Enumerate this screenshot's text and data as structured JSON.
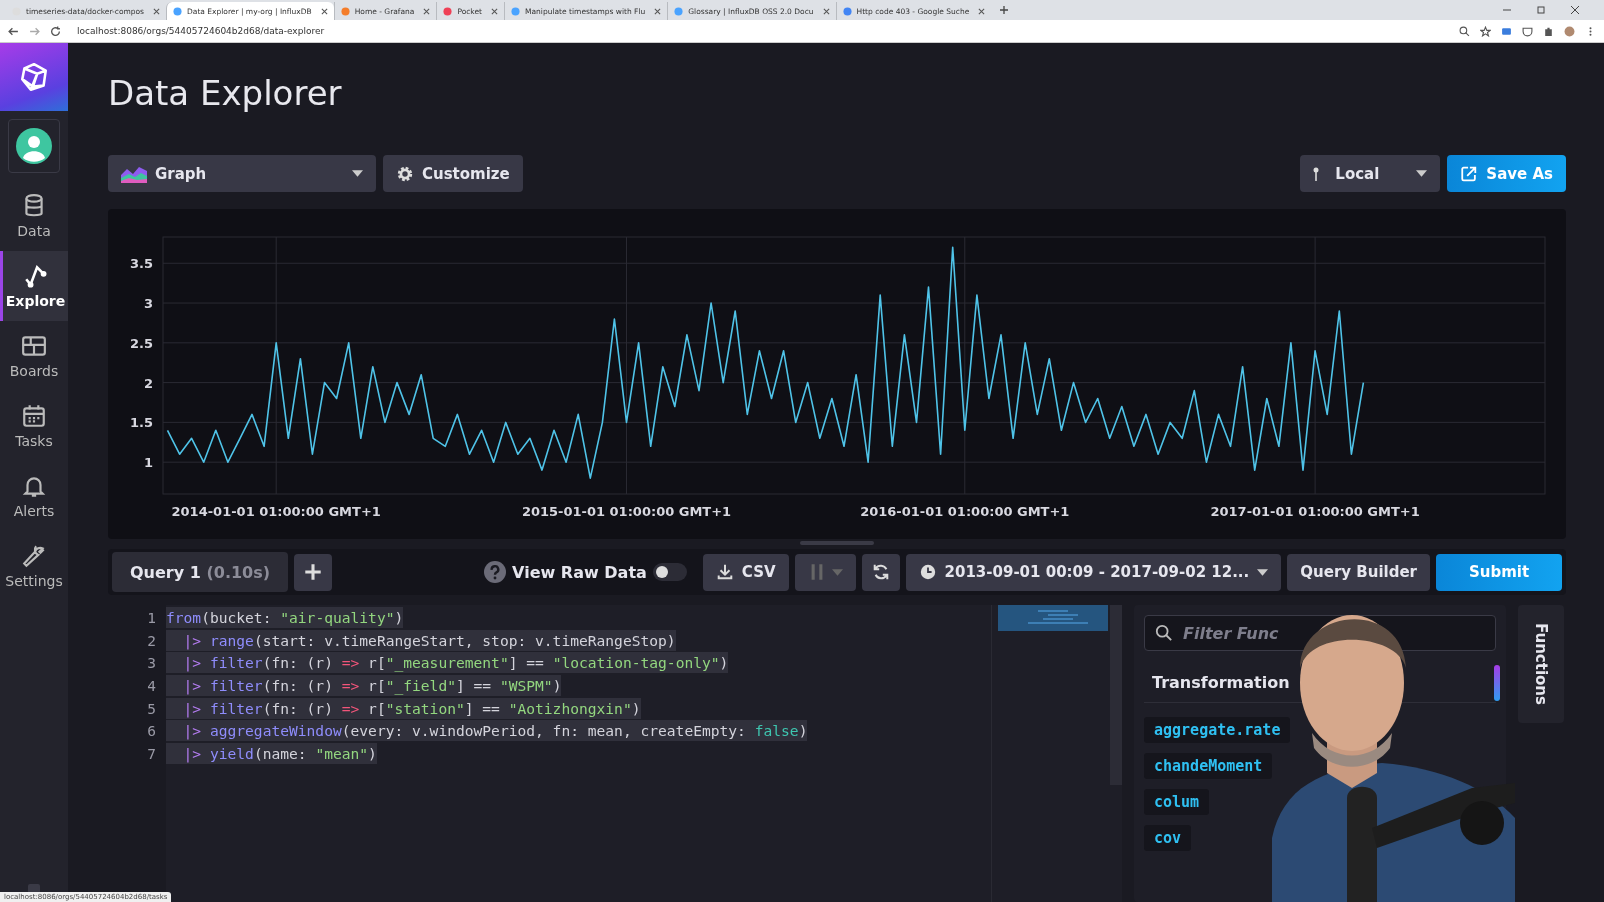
{
  "browser": {
    "tabs": [
      {
        "title": "timeseries-data/docker-compos",
        "selected": false,
        "kind": "github"
      },
      {
        "title": "Data Explorer | my-org | InfluxDB",
        "selected": true,
        "kind": "influx"
      },
      {
        "title": "Home - Grafana",
        "selected": false,
        "kind": "grafana"
      },
      {
        "title": "Pocket",
        "selected": false,
        "kind": "pocket"
      },
      {
        "title": "Manipulate timestamps with Flu",
        "selected": false,
        "kind": "influx"
      },
      {
        "title": "Glossary | InfluxDB OSS 2.0 Docu",
        "selected": false,
        "kind": "influx"
      },
      {
        "title": "Http code 403 - Google Suche",
        "selected": false,
        "kind": "google"
      }
    ],
    "url": "localhost:8086/orgs/54405724604b2d68/data-explorer",
    "status_url": "localhost:8086/orgs/54405724604b2d68/tasks"
  },
  "sidebar": {
    "items": [
      {
        "label": "Data",
        "kind": "database",
        "selected": false
      },
      {
        "label": "Explore",
        "kind": "explore",
        "selected": true
      },
      {
        "label": "Boards",
        "kind": "boards",
        "selected": false
      },
      {
        "label": "Tasks",
        "kind": "calendar",
        "selected": false
      },
      {
        "label": "Alerts",
        "kind": "bell",
        "selected": false
      },
      {
        "label": "Settings",
        "kind": "wrench",
        "selected": false
      }
    ]
  },
  "page": {
    "title": "Data Explorer"
  },
  "toolbar": {
    "graph_type": "Graph",
    "customize": "Customize",
    "bucket": "Local",
    "save": "Save As"
  },
  "chart": {
    "chart_data": {
      "type": "line",
      "grid": true,
      "ylim": [
        0.6,
        3.83
      ],
      "yticks": [
        1,
        1.5,
        2,
        2.5,
        3,
        3.5
      ],
      "categories": [
        null,
        null,
        null,
        null,
        null,
        null,
        null,
        null,
        null,
        "2014-01-01 01:00:00 GMT+1",
        null,
        null,
        null,
        null,
        null,
        null,
        null,
        null,
        null,
        null,
        null,
        null,
        null,
        null,
        null,
        null,
        null,
        null,
        null,
        null,
        null,
        null,
        null,
        null,
        null,
        null,
        null,
        null,
        "2015-01-01 01:00:00 GMT+1",
        null,
        null,
        null,
        null,
        null,
        null,
        null,
        null,
        null,
        null,
        null,
        null,
        null,
        null,
        null,
        null,
        null,
        null,
        null,
        null,
        null,
        null,
        null,
        null,
        null,
        null,
        null,
        "2016-01-01 01:00:00 GMT+1",
        null,
        null,
        null,
        null,
        null,
        null,
        null,
        null,
        null,
        null,
        null,
        null,
        null,
        null,
        null,
        null,
        null,
        null,
        null,
        null,
        null,
        null,
        null,
        null,
        null,
        null,
        null,
        null,
        "2017-01-01 01:00:00 GMT+1",
        null,
        null,
        null,
        null
      ],
      "series": [
        {
          "color": "#4fc3e8",
          "values": [
            1.4,
            1.1,
            1.3,
            1.0,
            1.4,
            1.0,
            1.3,
            1.6,
            1.2,
            2.5,
            1.3,
            2.3,
            1.1,
            2.0,
            1.8,
            2.5,
            1.3,
            2.2,
            1.5,
            2.0,
            1.6,
            2.1,
            1.3,
            1.2,
            1.6,
            1.1,
            1.4,
            1.0,
            1.5,
            1.1,
            1.3,
            0.9,
            1.4,
            1.0,
            1.6,
            0.8,
            1.5,
            2.8,
            1.5,
            2.5,
            1.2,
            2.2,
            1.7,
            2.6,
            1.9,
            3.0,
            2.0,
            2.9,
            1.6,
            2.4,
            1.8,
            2.4,
            1.5,
            2.0,
            1.3,
            1.8,
            1.2,
            2.1,
            1.0,
            3.1,
            1.2,
            2.6,
            1.5,
            3.2,
            1.1,
            3.7,
            1.4,
            3.1,
            1.8,
            2.6,
            1.3,
            2.5,
            1.6,
            2.3,
            1.4,
            2.0,
            1.5,
            1.8,
            1.3,
            1.7,
            1.2,
            1.6,
            1.1,
            1.5,
            1.3,
            1.9,
            1.0,
            1.6,
            1.2,
            2.2,
            0.9,
            1.8,
            1.2,
            2.5,
            0.9,
            2.4,
            1.6,
            2.9,
            1.1,
            2.0
          ]
        }
      ]
    }
  },
  "query": {
    "tab": {
      "label": "Query 1",
      "time": "(0.10s)"
    },
    "raw_data": {
      "label": "View Raw Data",
      "on": false
    },
    "csv": "CSV",
    "time_range": "2013-09-01 00:09 - 2017-09-02 12...",
    "builder": "Query Builder",
    "submit": "Submit"
  },
  "editor": {
    "lines": [
      {
        "number": "1",
        "selected": true,
        "tokens": [
          {
            "kind": "fn",
            "text": "from"
          },
          {
            "kind": "plain",
            "text": "(bucket: "
          },
          {
            "kind": "string",
            "text": "\"air-quality\""
          },
          {
            "kind": "plain",
            "text": ")"
          }
        ]
      },
      {
        "number": "2",
        "selected": true,
        "tokens": [
          {
            "kind": "pipe",
            "text": "  |> "
          },
          {
            "kind": "fn",
            "text": "range"
          },
          {
            "kind": "plain",
            "text": "(start: v.timeRangeStart, stop: v.timeRangeStop)"
          }
        ]
      },
      {
        "number": "3",
        "selected": true,
        "tokens": [
          {
            "kind": "pipe",
            "text": "  |> "
          },
          {
            "kind": "fn",
            "text": "filter"
          },
          {
            "kind": "plain",
            "text": "(fn: (r) "
          },
          {
            "kind": "arrow",
            "text": "=>"
          },
          {
            "kind": "plain",
            "text": " r["
          },
          {
            "kind": "string",
            "text": "\"_measurement\""
          },
          {
            "kind": "plain",
            "text": "] == "
          },
          {
            "kind": "string",
            "text": "\"location-tag-only\""
          },
          {
            "kind": "plain",
            "text": ")"
          }
        ]
      },
      {
        "number": "4",
        "selected": true,
        "tokens": [
          {
            "kind": "pipe",
            "text": "  |> "
          },
          {
            "kind": "fn",
            "text": "filter"
          },
          {
            "kind": "plain",
            "text": "(fn: (r) "
          },
          {
            "kind": "arrow",
            "text": "=>"
          },
          {
            "kind": "plain",
            "text": " r["
          },
          {
            "kind": "string",
            "text": "\"_field\""
          },
          {
            "kind": "plain",
            "text": "] == "
          },
          {
            "kind": "string",
            "text": "\"WSPM\""
          },
          {
            "kind": "plain",
            "text": ")"
          }
        ]
      },
      {
        "number": "5",
        "selected": true,
        "tokens": [
          {
            "kind": "pipe",
            "text": "  |> "
          },
          {
            "kind": "fn",
            "text": "filter"
          },
          {
            "kind": "plain",
            "text": "(fn: (r) "
          },
          {
            "kind": "arrow",
            "text": "=>"
          },
          {
            "kind": "plain",
            "text": " r["
          },
          {
            "kind": "string",
            "text": "\"station\""
          },
          {
            "kind": "plain",
            "text": "] == "
          },
          {
            "kind": "string",
            "text": "\"Aotizhongxin\""
          },
          {
            "kind": "plain",
            "text": ")"
          }
        ]
      },
      {
        "number": "6",
        "selected": true,
        "tokens": [
          {
            "kind": "pipe",
            "text": "  |> "
          },
          {
            "kind": "fn",
            "text": "aggregateWindow"
          },
          {
            "kind": "plain",
            "text": "(every: v.windowPeriod, fn: mean, createEmpty: "
          },
          {
            "kind": "bool",
            "text": "false"
          },
          {
            "kind": "plain",
            "text": ")"
          }
        ]
      },
      {
        "number": "7",
        "selected": true,
        "tokens": [
          {
            "kind": "pipe",
            "text": "  |> "
          },
          {
            "kind": "fn",
            "text": "yield"
          },
          {
            "kind": "plain",
            "text": "(name: "
          },
          {
            "kind": "string",
            "text": "\"mean\""
          },
          {
            "kind": "plain",
            "text": ")"
          }
        ]
      }
    ]
  },
  "functions": {
    "placeholder": "Filter Func",
    "heading": "Transformation",
    "items": [
      "aggregate.rate",
      "chandeMoment",
      "colum",
      "cov"
    ],
    "side_tab": "Functions"
  }
}
